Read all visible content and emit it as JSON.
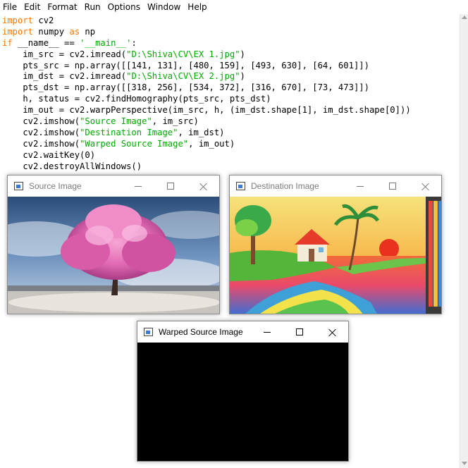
{
  "menubar": {
    "items": [
      "File",
      "Edit",
      "Format",
      "Run",
      "Options",
      "Window",
      "Help"
    ]
  },
  "code": {
    "lines": [
      [
        {
          "t": "import",
          "c": "kw"
        },
        {
          "t": " cv2",
          "c": ""
        }
      ],
      [
        {
          "t": "import",
          "c": "kw"
        },
        {
          "t": " numpy ",
          "c": ""
        },
        {
          "t": "as",
          "c": "kw"
        },
        {
          "t": " np",
          "c": ""
        }
      ],
      [
        {
          "t": "if",
          "c": "kw"
        },
        {
          "t": " __name__ == ",
          "c": ""
        },
        {
          "t": "'__main__'",
          "c": "str"
        },
        {
          "t": ":",
          "c": ""
        }
      ],
      [
        {
          "t": "    im_src = cv2.imread(",
          "c": ""
        },
        {
          "t": "\"D:\\Shiva\\CV\\EX 1.jpg\"",
          "c": "str"
        },
        {
          "t": ")",
          "c": ""
        }
      ],
      [
        {
          "t": "    pts_src = np.array([[141, 131], [480, 159], [493, 630], [64, 601]])",
          "c": ""
        }
      ],
      [
        {
          "t": "    im_dst = cv2.imread(",
          "c": ""
        },
        {
          "t": "\"D:\\Shiva\\CV\\EX 2.jpg\"",
          "c": "str"
        },
        {
          "t": ")",
          "c": ""
        }
      ],
      [
        {
          "t": "    pts_dst = np.array([[318, 256], [534, 372], [316, 670], [73, 473]])",
          "c": ""
        }
      ],
      [
        {
          "t": "    h, status = cv2.findHomography(pts_src, pts_dst)",
          "c": ""
        }
      ],
      [
        {
          "t": "    im_out = cv2.warpPerspective(im_src, h, (im_dst.shape[1], im_dst.shape[0]))",
          "c": ""
        }
      ],
      [
        {
          "t": "    cv2.imshow(",
          "c": ""
        },
        {
          "t": "\"Source Image\"",
          "c": "str"
        },
        {
          "t": ", im_src)",
          "c": ""
        }
      ],
      [
        {
          "t": "    cv2.imshow(",
          "c": ""
        },
        {
          "t": "\"Destination Image\"",
          "c": "str"
        },
        {
          "t": ", im_dst)",
          "c": ""
        }
      ],
      [
        {
          "t": "    cv2.imshow(",
          "c": ""
        },
        {
          "t": "\"Warped Source Image\"",
          "c": "str"
        },
        {
          "t": ", im_out)",
          "c": ""
        }
      ],
      [
        {
          "t": "    cv2.waitKey(0)",
          "c": ""
        }
      ],
      [
        {
          "t": "    cv2.destroyAllWindows()",
          "c": ""
        }
      ]
    ]
  },
  "windows": {
    "source": {
      "title": "Source Image",
      "icon": "window-app-icon"
    },
    "destination": {
      "title": "Destination Image",
      "icon": "window-app-icon"
    },
    "warped": {
      "title": "Warped Source Image",
      "icon": "window-app-icon"
    }
  },
  "colors": {
    "keyword": "#ff7700",
    "string": "#00aa00",
    "warped_canvas": "#000000"
  }
}
